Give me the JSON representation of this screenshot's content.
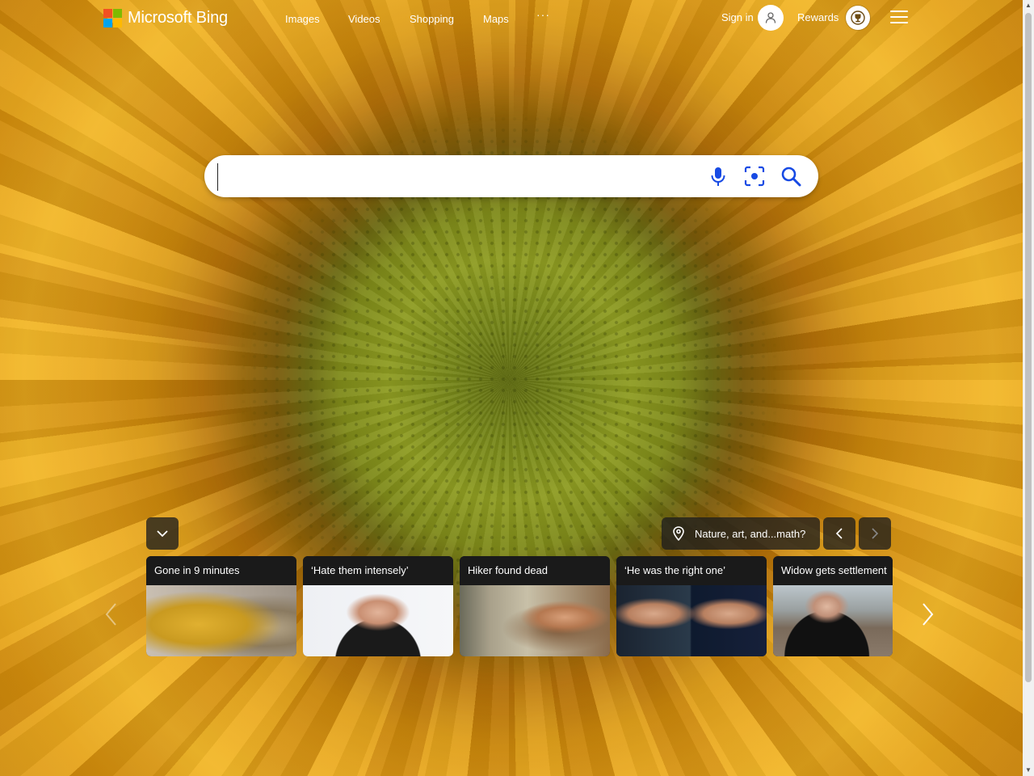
{
  "brand": {
    "name": "Microsoft Bing",
    "logo_colors": [
      "#f25022",
      "#7fba00",
      "#00a4ef",
      "#ffb900"
    ]
  },
  "header": {
    "nav": [
      {
        "label": "Images"
      },
      {
        "label": "Videos"
      },
      {
        "label": "Shopping"
      },
      {
        "label": "Maps"
      }
    ],
    "more_label": "···",
    "sign_in_label": "Sign in",
    "rewards_label": "Rewards",
    "icons": {
      "avatar": "user-icon",
      "rewards": "trophy-icon",
      "menu": "hamburger-menu-icon"
    }
  },
  "search": {
    "value": "",
    "placeholder": "",
    "icons": [
      "microphone-icon",
      "visual-search-icon",
      "search-icon"
    ]
  },
  "image_of_the_day": {
    "caption": "Nature, art, and...math?",
    "icon": "location-pin-icon"
  },
  "news": [
    {
      "title": "Gone in 9 minutes"
    },
    {
      "title": "‘Hate them intensely’"
    },
    {
      "title": "Hiker found dead"
    },
    {
      "title": "‘He was the right one’"
    },
    {
      "title": "Widow gets settlement"
    }
  ],
  "colors": {
    "accent": "#ffffff",
    "overlay": "#1e1e1e"
  }
}
